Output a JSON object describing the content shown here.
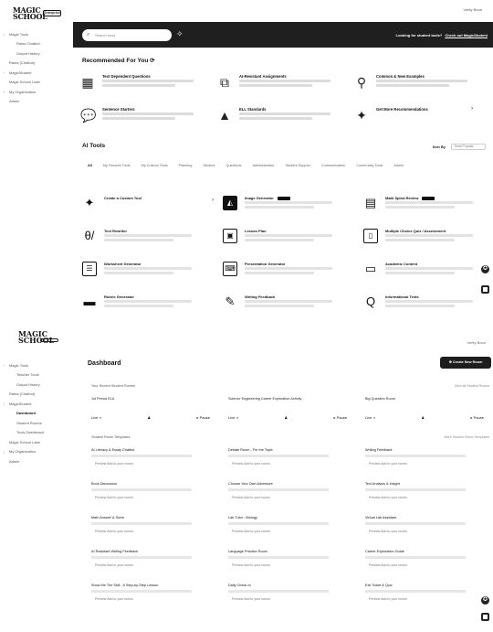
{
  "brand": {
    "logo_line1": "MAGIC",
    "logo_line2": "SCHOOL",
    "badge": "Enterprise"
  },
  "top": {
    "user": "Verity Boon",
    "search_placeholder": "Search tools",
    "cta_text": "Looking for student tools?",
    "cta_link": "Check out MagicStudent",
    "sidebar": [
      {
        "label": "Magic Tools",
        "sub": false,
        "active": false,
        "chev": true
      },
      {
        "label": "Raina Chatbot",
        "sub": true,
        "active": false,
        "chev": false
      },
      {
        "label": "Output History",
        "sub": true,
        "active": false,
        "chev": false
      },
      {
        "label": "Raina (Chatbot)",
        "sub": false,
        "active": false,
        "chev": false
      },
      {
        "label": "MagicStudent",
        "sub": false,
        "active": false,
        "chev": true
      },
      {
        "label": "Magic School Labs",
        "sub": false,
        "active": false,
        "chev": false
      },
      {
        "label": "My Organization",
        "sub": false,
        "active": false,
        "chev": true
      },
      {
        "label": "Admin",
        "sub": false,
        "active": false,
        "chev": false
      }
    ],
    "recommended_title": "Recommended For You",
    "recommended": [
      {
        "icon": "table-icon",
        "glyph": "▦",
        "title": "Text Dependent Questions"
      },
      {
        "icon": "ai-resistant-icon",
        "glyph": "⧉",
        "title": "AI-Resistant Assignments"
      },
      {
        "icon": "podium-icon",
        "glyph": "⚲",
        "title": "Common & New Examples"
      },
      {
        "icon": "speech-bubbles-icon",
        "glyph": "💬",
        "title": "Sentence Starters"
      },
      {
        "icon": "ell-icon",
        "glyph": "▲",
        "title": "ELL Standards"
      },
      {
        "icon": "sparkle-icon",
        "glyph": "✦",
        "title": "Get More Recommendations"
      }
    ],
    "ai_tools_title": "AI Tools",
    "sort_label": "Sort By",
    "sort_value": "Most Popular",
    "filters": [
      "All",
      "My Favorite Tools",
      "My Custom Tools",
      "Planning",
      "Student",
      "Questions",
      "Administrative",
      "Student Support",
      "Communication",
      "Community Tools",
      "Admin"
    ],
    "tools": [
      {
        "icon": "sparkle-icon",
        "glyph": "✦",
        "title": "Create a Custom Tool",
        "style": "plain",
        "badge": false,
        "arrow": true
      },
      {
        "icon": "image-generator-icon",
        "glyph": "◭",
        "title": "Image Generator",
        "style": "dark",
        "badge": true,
        "arrow": false
      },
      {
        "icon": "abacus-icon",
        "glyph": "▤",
        "title": "Math Spiral Review",
        "style": "plain",
        "badge": true,
        "arrow": false
      },
      {
        "icon": "text-rewriter-icon",
        "glyph": "θ/",
        "title": "Text Rewriter",
        "style": "plain",
        "badge": false,
        "arrow": false
      },
      {
        "icon": "lesson-plan-icon",
        "glyph": "▣",
        "title": "Lesson Plan",
        "style": "box",
        "badge": false,
        "arrow": false
      },
      {
        "icon": "quiz-icon",
        "glyph": "▯",
        "title": "Multiple Choice Quiz / Assessment",
        "style": "box",
        "badge": false,
        "arrow": false
      },
      {
        "icon": "worksheet-icon",
        "glyph": "☰",
        "title": "Worksheet Generator",
        "style": "box",
        "badge": false,
        "arrow": false
      },
      {
        "icon": "presentation-icon",
        "glyph": "⌨",
        "title": "Presentation Generator",
        "style": "box",
        "badge": false,
        "arrow": false
      },
      {
        "icon": "laptop-icon",
        "glyph": "▭",
        "title": "Academic Content",
        "style": "plain",
        "badge": false,
        "arrow": false
      },
      {
        "icon": "rubric-icon",
        "glyph": "▬",
        "title": "Rubric Generator",
        "style": "plain",
        "badge": false,
        "arrow": false
      },
      {
        "icon": "writing-feedback-icon",
        "glyph": "✎",
        "title": "Writing Feedback",
        "style": "plain",
        "badge": false,
        "arrow": false
      },
      {
        "icon": "informational-text-icon",
        "glyph": "Q",
        "title": "Informational Texts",
        "style": "plain",
        "badge": false,
        "arrow": false
      }
    ]
  },
  "bottom": {
    "user": "Verity Boon",
    "sidebar": [
      {
        "label": "Magic Tools",
        "sub": false,
        "active": false,
        "chev": true
      },
      {
        "label": "Teacher Tools",
        "sub": true,
        "active": false,
        "chev": false
      },
      {
        "label": "Output History",
        "sub": true,
        "active": false,
        "chev": false
      },
      {
        "label": "Raina (Chatbot)",
        "sub": false,
        "active": false,
        "chev": false
      },
      {
        "label": "MagicStudent",
        "sub": false,
        "active": false,
        "chev": true
      },
      {
        "label": "Dashboard",
        "sub": true,
        "active": true,
        "chev": false
      },
      {
        "label": "Student Rooms",
        "sub": true,
        "active": false,
        "chev": false
      },
      {
        "label": "Tools Dashboard",
        "sub": true,
        "active": false,
        "chev": false
      },
      {
        "label": "Magic School Labs",
        "sub": false,
        "active": false,
        "chev": false
      },
      {
        "label": "My Organization",
        "sub": false,
        "active": false,
        "chev": true
      },
      {
        "label": "Admin",
        "sub": false,
        "active": false,
        "chev": false
      }
    ],
    "title": "Dashboard",
    "create_button": "Create New Room",
    "recent_label": "Your Recent Student Rooms",
    "recent_link": "View all Student Rooms",
    "rooms": [
      {
        "name": "1st Period ELA",
        "status": "Live",
        "action": "Pause"
      },
      {
        "name": "Science Engineering Career Exploration Activity",
        "status": "Live",
        "action": "Pause"
      },
      {
        "name": "Big Question Room",
        "status": "Live",
        "action": "Pause"
      }
    ],
    "templates_label": "Student Room Templates",
    "templates_link": "More Student Room Templates",
    "templates": [
      {
        "name": "AI Literacy & Essay Chatbot"
      },
      {
        "name": "Debate Room - For the Topic"
      },
      {
        "name": "Writing Feedback"
      },
      {
        "name": "Book Discussion"
      },
      {
        "name": "Choose Your Own Adventure"
      },
      {
        "name": "Text Analysis & Insight"
      },
      {
        "name": "Math Answer & Solve"
      },
      {
        "name": "Lab Tutor - Biology"
      },
      {
        "name": "Virtual Lab Assistant"
      },
      {
        "name": "AI Resistant Writing Feedback"
      },
      {
        "name": "Language Practice Room"
      },
      {
        "name": "Career Exploration Guide"
      },
      {
        "name": "Show Me The Skill - A Step-by-Step Lesson"
      },
      {
        "name": "Daily Check-In"
      },
      {
        "name": "Exit Ticket & Quiz"
      }
    ],
    "template_action": "Preview  Add to your rooms"
  }
}
